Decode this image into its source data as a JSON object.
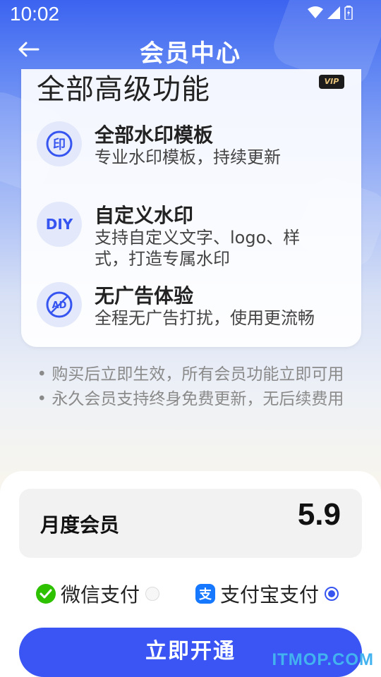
{
  "status": {
    "time": "10:02"
  },
  "nav": {
    "title": "会员中心",
    "back_icon": "arrow-left-icon"
  },
  "card": {
    "title": "全部高级功能",
    "vip_badge": "VIP",
    "features": [
      {
        "icon": "stamp-icon",
        "icon_text": "印",
        "name": "全部水印模板",
        "desc": "专业水印模板，持续更新"
      },
      {
        "icon": "diy-icon",
        "icon_text": "DIY",
        "name": "自定义水印",
        "desc": "支持自定义文字、logo、样式，打造专属水印"
      },
      {
        "icon": "no-ad-icon",
        "icon_text": "AD",
        "name": "无广告体验",
        "desc": "全程无广告打扰，使用更流畅"
      }
    ]
  },
  "notes": [
    "• 购买后立即生效，所有会员功能立即可用",
    "• 永久会员支持终身免费更新，无后续费用"
  ],
  "plan": {
    "name": "月度会员",
    "price": "5.9"
  },
  "payment": {
    "options": [
      {
        "label": "微信支付",
        "icon": "wechat-pay-icon",
        "selected": false
      },
      {
        "label": "支付宝支付",
        "icon": "alipay-icon",
        "selected": true
      }
    ]
  },
  "cta": {
    "label": "立即开通"
  },
  "watermark": {
    "text": "ITMOP.COM"
  },
  "colors": {
    "accent": "#3a55f3",
    "wechat": "#2dc100",
    "alipay": "#1677ff"
  }
}
